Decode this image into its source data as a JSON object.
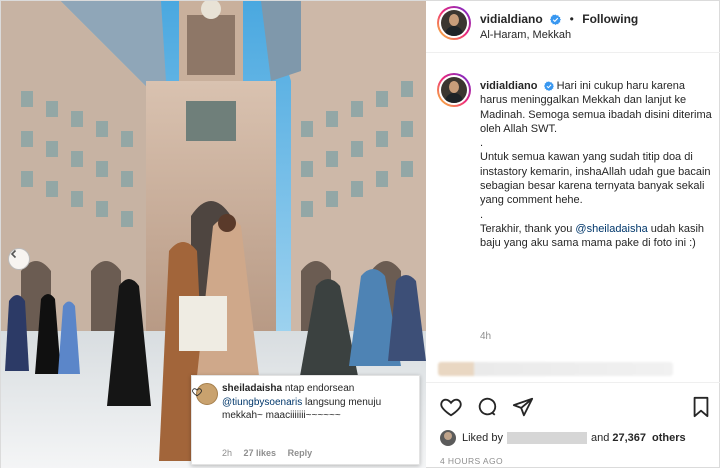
{
  "post": {
    "username": "vidialdiano",
    "follow_status": "Following",
    "location": "Al-Haram, Mekkah",
    "caption_paragraphs": [
      "Hari ini cukup haru karena harus meninggalkan Mekkah dan lanjut ke Madinah. Semoga semua ibadah disini diterima oleh Allah SWT.",
      ".",
      "Untuk semua kawan yang sudah titip doa di instastory kemarin, inshaAllah udah gue bacain sebagian besar karena ternyata banyak sekali yang comment hehe.",
      ".",
      "Terakhir, thank you"
    ],
    "caption_mention": "@sheiladaisha",
    "caption_tail": "udah kasih baju yang aku sama mama pake di foto ini :)",
    "caption_age": "4h"
  },
  "comment_overlay": {
    "username": "sheiladaisha",
    "text_before": "ntap endorsean",
    "mention": "@tiungbysoenaris",
    "text_after": "langsung menuju mekkah~ maaciiiiiii~~~~~~",
    "age": "2h",
    "likes": "27 likes",
    "reply_label": "Reply"
  },
  "likes": {
    "liked_by_label": "Liked by",
    "and_label": "and",
    "count": "27,367",
    "others_label": "others"
  },
  "posted_ago": "4 HOURS AGO",
  "icons": {
    "heart": "heart-icon",
    "comment": "comment-icon",
    "share": "paper-plane-icon",
    "save": "bookmark-icon",
    "verified": "verified-badge-icon",
    "carousel_prev": "chevron-left-icon"
  },
  "colors": {
    "verified": "#3897f0",
    "link": "#00376b",
    "muted": "#8e8e8e",
    "text": "#262626"
  }
}
